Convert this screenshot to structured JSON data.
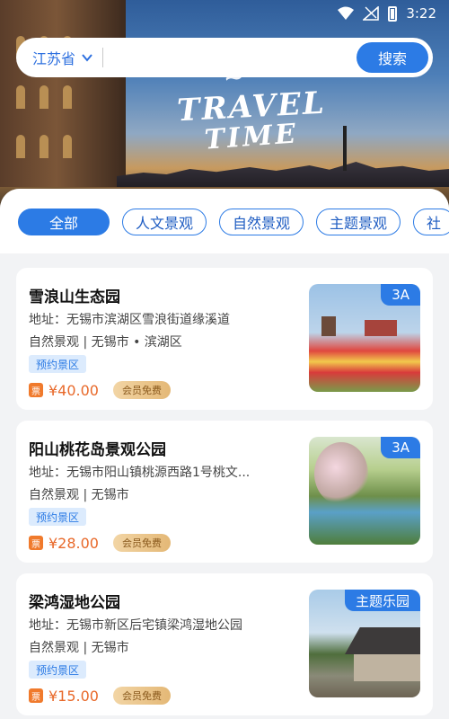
{
  "status_bar": {
    "time": "3:22"
  },
  "hero": {
    "line1": "~ ~",
    "line2": "TRAVEL",
    "line3": "TIME"
  },
  "search": {
    "region": "江苏省",
    "placeholder": "",
    "button": "搜索"
  },
  "tabs": [
    {
      "label": "全部",
      "active": true
    },
    {
      "label": "人文景观",
      "active": false
    },
    {
      "label": "自然景观",
      "active": false
    },
    {
      "label": "主题景观",
      "active": false
    },
    {
      "label": "社",
      "active": false
    }
  ],
  "spots": [
    {
      "name": "雪浪山生态园",
      "address": "地址：无锡市滨湖区雪浪街道缘溪道",
      "meta": "自然景观 | 无锡市 • 滨湖区",
      "tag": "预约景区",
      "price": "¥40.00",
      "vip": "会员免费",
      "badge": "3A"
    },
    {
      "name": "阳山桃花岛景观公园",
      "address": "地址：无锡市阳山镇桃源西路1号桃文...",
      "meta": "自然景观 | 无锡市",
      "tag": "预约景区",
      "price": "¥28.00",
      "vip": "会员免费",
      "badge": "3A"
    },
    {
      "name": "梁鸿湿地公园",
      "address": "地址：无锡市新区后宅镇梁鸿湿地公园",
      "meta": "自然景观 | 无锡市",
      "tag": "预约景区",
      "price": "¥15.00",
      "vip": "会员免费",
      "badge": "主题乐园"
    }
  ],
  "colors": {
    "accent": "#2c7be5",
    "price": "#e8692a"
  }
}
